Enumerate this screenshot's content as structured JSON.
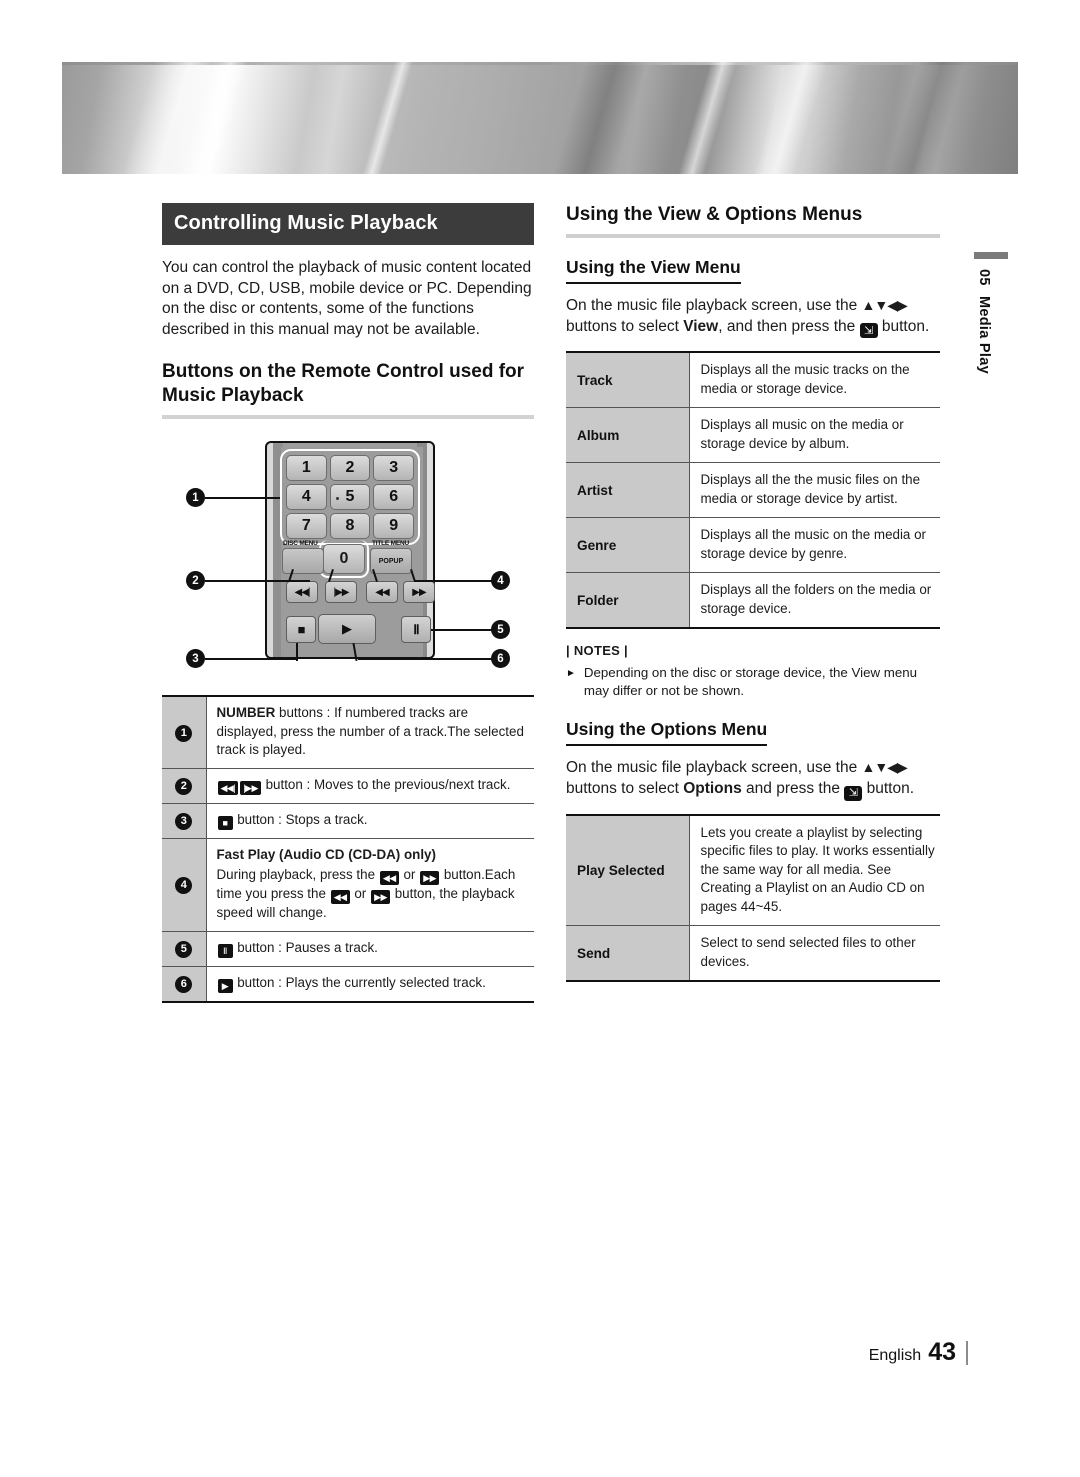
{
  "sidebar": {
    "chapter_number": "05",
    "chapter_title": "Media Play"
  },
  "footer": {
    "language": "English",
    "page_number": "43"
  },
  "left": {
    "section_title": "Controlling Music Playback",
    "intro": "You can control the playback of music content located on a DVD, CD, USB, mobile device or PC. Depending on the disc or contents, some of the functions described in this manual may not be available.",
    "subsection_title": "Buttons on the Remote Control used for Music Playback",
    "remote": {
      "keys": [
        "1",
        "2",
        "3",
        "4",
        "5",
        "6",
        "7",
        "8",
        "9"
      ],
      "zero_key": "0",
      "popup_label": "POPUP",
      "disc_menu_label": "DISC MENU",
      "title_menu_label": "TITLE MENU",
      "prev_label": "◀◀|",
      "next_label": "|▶▶",
      "rew_label": "◀◀",
      "ff_label": "▶▶",
      "stop_label": "■",
      "play_label": "▶",
      "pause_label": "Ⅱ",
      "callouts": [
        "1",
        "2",
        "3",
        "4",
        "5",
        "6"
      ]
    },
    "button_table": [
      {
        "num": "1",
        "bold_lead": "NUMBER",
        "text": " buttons : If numbered tracks are displayed, press the number of a track.The selected track is played."
      },
      {
        "num": "2",
        "icons": [
          "◀◀|",
          "|▶▶"
        ],
        "text": " button : Moves to the previous/next track."
      },
      {
        "num": "3",
        "icons": [
          "■"
        ],
        "text": " button : Stops a track."
      },
      {
        "num": "4",
        "heading": "Fast Play (Audio CD (CD-DA) only)",
        "line1_a": "During playback, press the ",
        "line1_b": " or ",
        "line1_c": " button.",
        "line2_a": "Each time you press the ",
        "line2_b": " or ",
        "line2_c": " button, the playback speed will change.",
        "rew": "◀◀",
        "ff": "▶▶"
      },
      {
        "num": "5",
        "icons": [
          "Ⅱ"
        ],
        "text": " button : Pauses a track."
      },
      {
        "num": "6",
        "icons": [
          "▶"
        ],
        "text": " button : Plays the currently selected track."
      }
    ]
  },
  "right": {
    "section_title": "Using the View & Options Menus",
    "view_menu": {
      "heading": "Using the View Menu",
      "intro_a": "On the music file playback screen, use the ",
      "arrows": "▲▼◀▶",
      "intro_b": " buttons to select ",
      "intro_bold": "View",
      "intro_c": ", and then press the ",
      "intro_d": " button.",
      "rows": [
        {
          "key": "Track",
          "value": "Displays all the music tracks on the media or storage device."
        },
        {
          "key": "Album",
          "value": "Displays all music on the media or storage device by album."
        },
        {
          "key": "Artist",
          "value": "Displays all the the music files on the media or storage device by artist."
        },
        {
          "key": "Genre",
          "value": "Displays all the music on the media or storage device by genre."
        },
        {
          "key": "Folder",
          "value": "Displays all the folders on the media or storage device."
        }
      ]
    },
    "notes": {
      "title": "| NOTES |",
      "items": [
        "Depending on the disc or storage device, the View menu may differ or not be shown."
      ]
    },
    "options_menu": {
      "heading": "Using the Options Menu",
      "intro_a": "On the music file playback screen, use the ",
      "arrows": "▲▼◀▶",
      "intro_b": " buttons to select ",
      "intro_bold": "Options",
      "intro_c": " and press the ",
      "intro_d": " button.",
      "rows": [
        {
          "key": "Play Selected",
          "value": "Lets you create a playlist by selecting specific files to play. It works essentially the same way for all media. See Creating a Playlist on an Audio CD on pages 44~45."
        },
        {
          "key": "Send",
          "value": "Select to send selected files to other devices."
        }
      ]
    }
  }
}
